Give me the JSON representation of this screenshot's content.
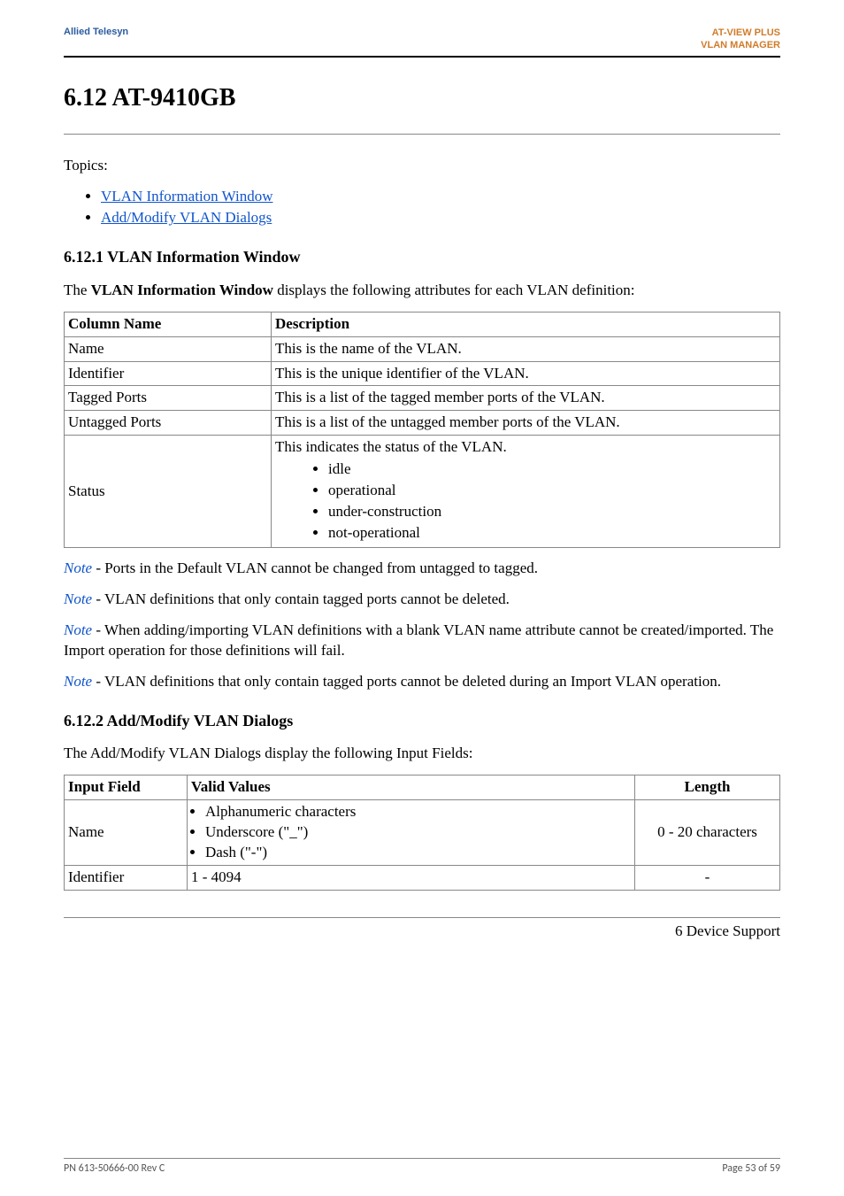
{
  "header": {
    "left": "Allied Telesyn",
    "right_line1": "AT-VIEW PLUS",
    "right_line2": "VLAN MANAGER"
  },
  "section_title": "6.12 AT-9410GB",
  "topics_label": "Topics:",
  "topics_links": {
    "vlan_info": "VLAN Information Window",
    "add_modify": "Add/Modify VLAN Dialogs"
  },
  "subsections": {
    "vlan_info_heading": "6.12.1 VLAN Information Window",
    "vlan_info_intro_prefix": "The ",
    "vlan_info_intro_strong": "VLAN Information Window",
    "vlan_info_intro_suffix": " displays the following attributes for each VLAN definition:",
    "add_modify_heading": "6.12.2 Add/Modify VLAN Dialogs",
    "add_modify_intro": "The Add/Modify VLAN Dialogs display the following Input Fields:"
  },
  "info_table": {
    "headers": {
      "col1": "Column Name",
      "col2": "Description"
    },
    "rows": [
      {
        "name": "Name",
        "desc": "This is the name of the VLAN."
      },
      {
        "name": "Identifier",
        "desc": "This is the unique identifier of the VLAN."
      },
      {
        "name": "Tagged Ports",
        "desc": "This is a list of the tagged member ports of the VLAN."
      },
      {
        "name": "Untagged Ports",
        "desc": "This is a list of the untagged member ports of the VLAN."
      }
    ],
    "status_row": {
      "name": "Status",
      "desc_lead": "This indicates the status of the VLAN.",
      "items": [
        "idle",
        "operational",
        "under-construction",
        "not-operational"
      ]
    }
  },
  "notes": {
    "label": "Note",
    "n1": " - Ports in the Default VLAN cannot be changed from untagged to tagged.",
    "n2": " - VLAN definitions that only contain tagged ports cannot be deleted.",
    "n3": " - When adding/importing VLAN definitions with a blank VLAN name attribute cannot be created/imported. The Import operation for those definitions will fail.",
    "n4": " - VLAN definitions that only contain tagged ports cannot be deleted during an Import VLAN operation."
  },
  "input_table": {
    "headers": {
      "c1": "Input Field",
      "c2": "Valid Values",
      "c3": "Length"
    },
    "rows": {
      "name": {
        "field": "Name",
        "valids": [
          "Alphanumeric characters",
          "Underscore (\"_\")",
          "Dash (\"-\")"
        ],
        "length": "0 - 20 characters"
      },
      "identifier": {
        "field": "Identifier",
        "valid_single": "1 - 4094",
        "length": "-"
      }
    }
  },
  "bottom_link": "6 Device Support",
  "footer": {
    "left": "PN 613-50666-00 Rev C",
    "right": "Page 53 of 59"
  }
}
